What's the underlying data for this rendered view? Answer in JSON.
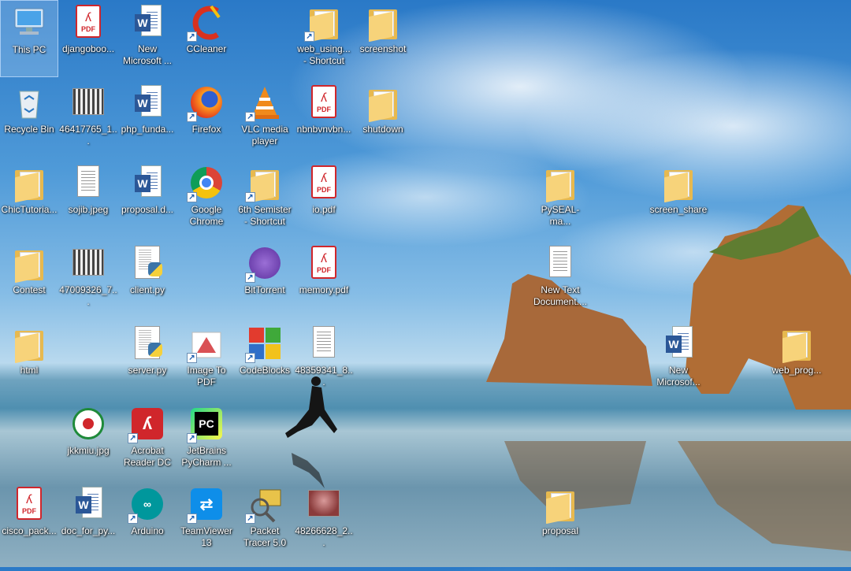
{
  "desktop": {
    "icons": [
      {
        "label": "This PC",
        "type": "pc",
        "shortcut": false,
        "selected": true
      },
      {
        "label": "djangoboo...",
        "type": "pdf",
        "shortcut": false
      },
      {
        "label": "New Microsoft ...",
        "type": "word",
        "shortcut": false
      },
      {
        "label": "CCleaner",
        "type": "ccleaner",
        "shortcut": true
      },
      {
        "label": "web_using... - Shortcut",
        "type": "folder",
        "shortcut": true
      },
      {
        "label": "screenshot",
        "type": "folder",
        "shortcut": false
      },
      {
        "label": "Recycle Bin",
        "type": "recycle",
        "shortcut": false
      },
      {
        "label": "46417765_1...",
        "type": "image",
        "shortcut": false
      },
      {
        "label": "php_funda...",
        "type": "word",
        "shortcut": false
      },
      {
        "label": "Firefox",
        "type": "firefox",
        "shortcut": true
      },
      {
        "label": "VLC media player",
        "type": "vlc",
        "shortcut": true
      },
      {
        "label": "nbnbvnvbn...",
        "type": "pdf",
        "shortcut": false
      },
      {
        "label": "shutdown",
        "type": "folder",
        "shortcut": false
      },
      {
        "label": "ChicTutoria...",
        "type": "folder",
        "shortcut": false
      },
      {
        "label": "sojib.jpeg",
        "type": "textdoc",
        "shortcut": false
      },
      {
        "label": "proposal.d...",
        "type": "word",
        "shortcut": false
      },
      {
        "label": "Google Chrome",
        "type": "chrome",
        "shortcut": true
      },
      {
        "label": "6th Semister - Shortcut",
        "type": "folder",
        "shortcut": true
      },
      {
        "label": "io.pdf",
        "type": "pdf",
        "shortcut": false
      },
      {
        "label": "PySEAL-ma...",
        "type": "folder",
        "shortcut": false
      },
      {
        "label": "screen_share",
        "type": "folder",
        "shortcut": false
      },
      {
        "label": "Contest",
        "type": "folder",
        "shortcut": false
      },
      {
        "label": "47009326_7...",
        "type": "image",
        "shortcut": false
      },
      {
        "label": "client.py",
        "type": "python",
        "shortcut": false
      },
      {
        "label": "BitTorrent",
        "type": "bittorrent",
        "shortcut": true
      },
      {
        "label": "memory.pdf",
        "type": "pdf",
        "shortcut": false
      },
      {
        "label": "New Text Document....",
        "type": "textdoc",
        "shortcut": false
      },
      {
        "label": "html",
        "type": "folder",
        "shortcut": false
      },
      {
        "label": "server.py",
        "type": "python",
        "shortcut": false
      },
      {
        "label": "Image To PDF",
        "type": "imagetopdf",
        "shortcut": true
      },
      {
        "label": "CodeBlocks",
        "type": "codeblocks",
        "shortcut": true
      },
      {
        "label": "48359341_8...",
        "type": "textdoc",
        "shortcut": false
      },
      {
        "label": "New Microsof...",
        "type": "word",
        "shortcut": false
      },
      {
        "label": "web_prog...",
        "type": "folder",
        "shortcut": false
      },
      {
        "label": "jkkmiu.jpg",
        "type": "logo",
        "shortcut": false
      },
      {
        "label": "Acrobat Reader DC",
        "type": "acrobat",
        "shortcut": true
      },
      {
        "label": "JetBrains PyCharm ...",
        "type": "pycharm",
        "shortcut": true
      },
      {
        "label": "cisco_pack...",
        "type": "pdf",
        "shortcut": false
      },
      {
        "label": "doc_for_py...",
        "type": "word",
        "shortcut": false
      },
      {
        "label": "Arduino",
        "type": "arduino",
        "shortcut": true
      },
      {
        "label": "TeamViewer 13",
        "type": "teamviewer",
        "shortcut": true
      },
      {
        "label": "Packet Tracer 5.0",
        "type": "packettracer",
        "shortcut": true
      },
      {
        "label": "48266628_2...",
        "type": "photo",
        "shortcut": false
      },
      {
        "label": "proposal",
        "type": "folder",
        "shortcut": false
      }
    ],
    "glyphs": {
      "pdf_text": "PDF",
      "word_letter": "W",
      "pycharm_text": "PC",
      "arrow": "↗"
    },
    "colors": {
      "pdf_red": "#d0262b",
      "word_blue": "#2b5797",
      "folder_yellow": "#f7d37a",
      "chrome_red": "#db4437",
      "chrome_yellow": "#f4c20d",
      "chrome_green": "#0f9d58",
      "chrome_blue": "#4285f4"
    }
  }
}
